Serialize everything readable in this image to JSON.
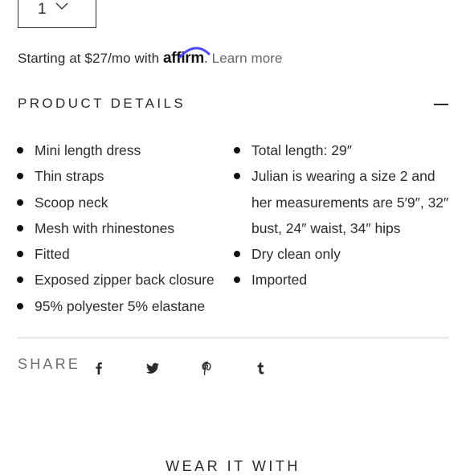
{
  "quantity": {
    "value": "1"
  },
  "affirm": {
    "prefix": "Starting at $27/mo with",
    "brand": "affirm",
    "suffix": ".",
    "link": "Learn more"
  },
  "product_details": {
    "title": "PRODUCT DETAILS",
    "left": [
      "Mini length dress",
      "Thin straps",
      "Scoop neck",
      "Mesh with rhinestones",
      "Fitted",
      "Exposed zipper back closure",
      "95% polyester 5% elastane"
    ],
    "right": [
      "Total length: 29″",
      "Julian is wearing a size 2 and her measurements are 5′9″, 32″ bust, 24″ waist, 34″ hips",
      "Dry clean only",
      "Imported"
    ]
  },
  "share": {
    "label": "SHARE",
    "icons": [
      "facebook-icon",
      "twitter-icon",
      "pinterest-icon",
      "tumblr-icon"
    ]
  },
  "wear_it_with": {
    "title": "WEAR IT WITH"
  },
  "colors": {
    "text": "#2b2b2b",
    "muted": "#6f6f6f",
    "divider": "#cfcfcf",
    "affirm_arc": "#4a4af4"
  }
}
